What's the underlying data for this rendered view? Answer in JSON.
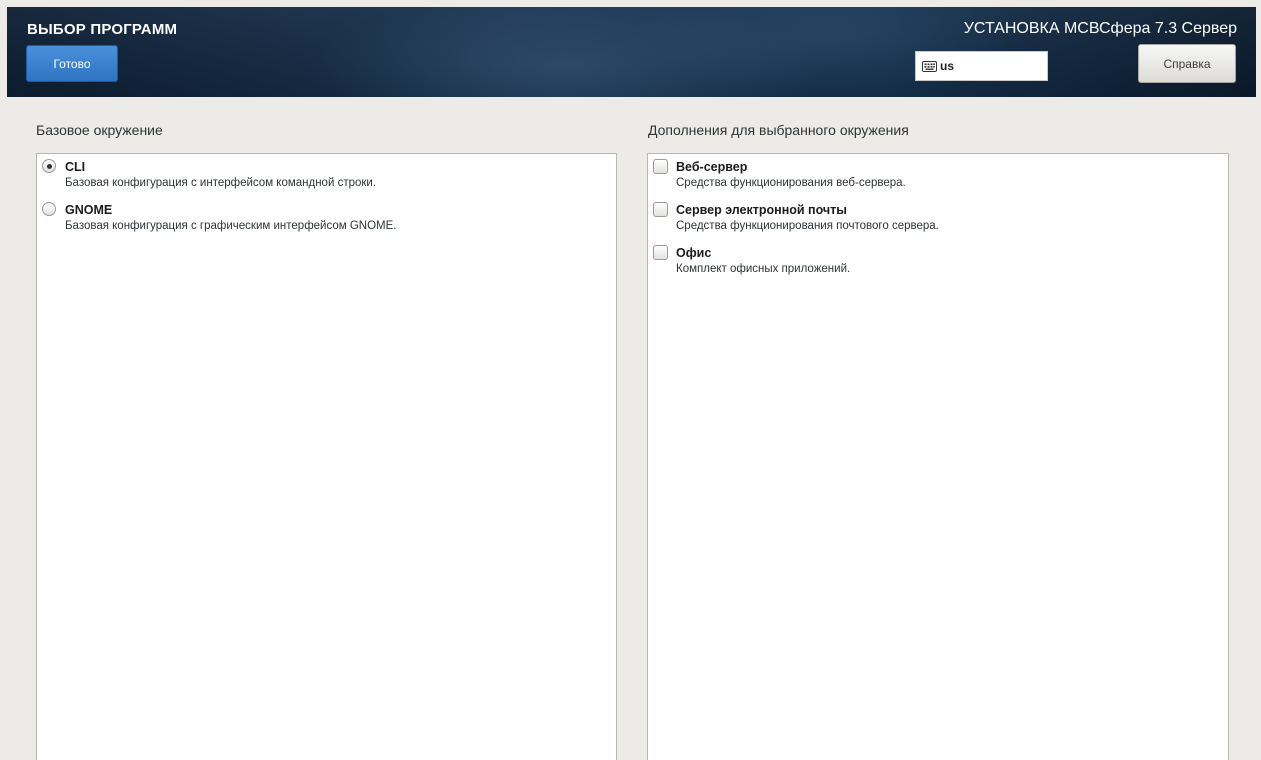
{
  "header": {
    "spoke_title": "ВЫБОР ПРОГРАММ",
    "done_label": "Готово",
    "product_title": "УСТАНОВКА МСВСфера 7.3 Сервер",
    "keyboard_layout": "us",
    "keyboard_icon": "keyboard-icon",
    "help_label": "Справка",
    "done_color": "#3a82d0"
  },
  "base_environment": {
    "heading": "Базовое окружение",
    "selected": "CLI",
    "options": [
      {
        "name": "CLI",
        "description": "Базовая конфигурация с интерфейсом командной строки.",
        "selected": true
      },
      {
        "name": "GNOME",
        "description": "Базовая конфигурация с графическим интерфейсом GNOME.",
        "selected": false
      }
    ]
  },
  "addons": {
    "heading": "Дополнения для выбранного окружения",
    "options": [
      {
        "name": "Веб-сервер",
        "description": "Средства функционирования веб-сервера.",
        "checked": false
      },
      {
        "name": "Сервер электронной почты",
        "description": "Средства функционирования почтового сервера.",
        "checked": false
      },
      {
        "name": "Офис",
        "description": "Комплект офисных приложений.",
        "checked": false
      }
    ]
  }
}
